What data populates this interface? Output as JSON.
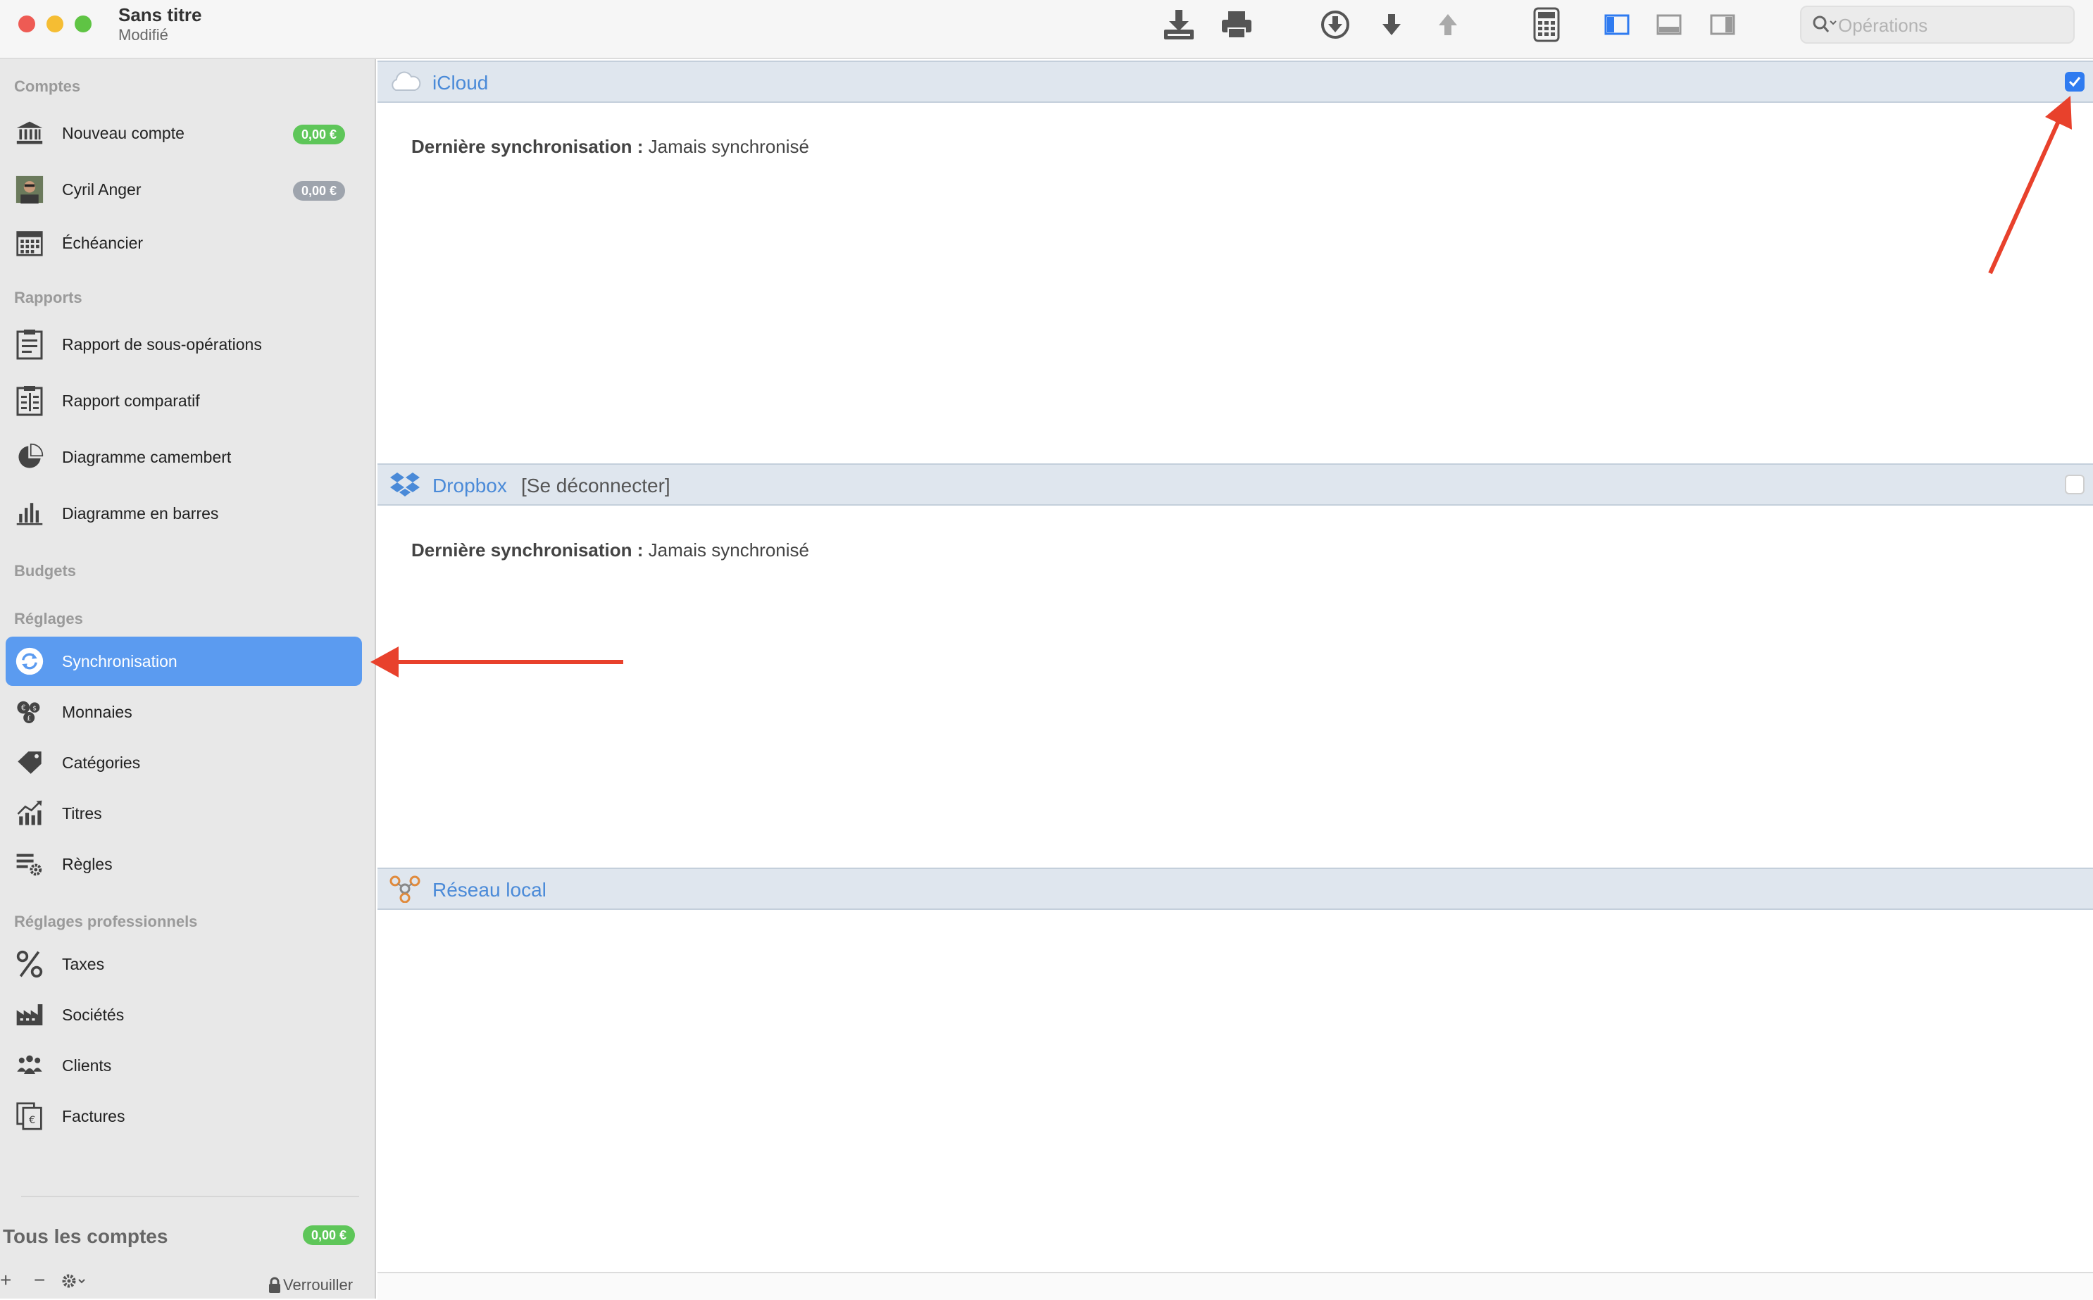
{
  "window": {
    "title": "Sans titre",
    "subtitle": "Modifié"
  },
  "toolbar": {
    "buttons": [
      {
        "name": "import-icon"
      },
      {
        "name": "print-icon"
      },
      {
        "name": "download-circle-icon"
      },
      {
        "name": "arrow-down-icon"
      },
      {
        "name": "arrow-up-icon"
      },
      {
        "name": "calculator-icon"
      },
      {
        "name": "sidebar-left-icon"
      },
      {
        "name": "panel-bottom-icon"
      },
      {
        "name": "sidebar-right-icon"
      }
    ],
    "search_placeholder": "Opérations"
  },
  "sidebar": {
    "sections": {
      "comptes": "Comptes",
      "rapports": "Rapports",
      "budgets": "Budgets",
      "reglages": "Réglages",
      "reglages_pro": "Réglages professionnels"
    },
    "comptes": [
      {
        "label": "Nouveau compte",
        "badge": "0,00 €",
        "badge_color": "#5ec659",
        "icon": "bank-icon"
      },
      {
        "label": "Cyril Anger",
        "badge": "0,00 €",
        "badge_color": "#9ea4ad",
        "icon": "avatar"
      },
      {
        "label": "Échéancier",
        "icon": "calendar-icon"
      }
    ],
    "rapports": [
      {
        "label": "Rapport de sous-opérations",
        "icon": "report-icon"
      },
      {
        "label": "Rapport comparatif",
        "icon": "comparative-report-icon"
      },
      {
        "label": "Diagramme camembert",
        "icon": "pie-chart-icon"
      },
      {
        "label": "Diagramme en barres",
        "icon": "bar-chart-icon"
      }
    ],
    "reglages": [
      {
        "label": "Synchronisation",
        "icon": "sync-icon",
        "selected": true
      },
      {
        "label": "Monnaies",
        "icon": "currencies-icon"
      },
      {
        "label": "Catégories",
        "icon": "tag-icon"
      },
      {
        "label": "Titres",
        "icon": "stocks-icon"
      },
      {
        "label": "Règles",
        "icon": "rules-icon"
      }
    ],
    "reglages_pro": [
      {
        "label": "Taxes",
        "icon": "percent-icon"
      },
      {
        "label": "Sociétés",
        "icon": "factory-icon"
      },
      {
        "label": "Clients",
        "icon": "clients-icon"
      },
      {
        "label": "Factures",
        "icon": "invoices-icon"
      }
    ],
    "footer": {
      "all_accounts_label": "Tous les comptes",
      "all_accounts_badge": "0,00 €",
      "add": "+",
      "remove": "−",
      "lock_label": "Verrouiller"
    }
  },
  "main": {
    "panels": [
      {
        "title": "iCloud",
        "action": "",
        "checked": true,
        "sync_label": "Dernière synchronisation :",
        "sync_value": "Jamais synchronisé"
      },
      {
        "title": "Dropbox",
        "action": "[Se déconnecter]",
        "checked": false,
        "sync_label": "Dernière synchronisation :",
        "sync_value": "Jamais synchronisé"
      },
      {
        "title": "Réseau local",
        "action": "",
        "checked": null
      }
    ]
  },
  "colors": {
    "accent": "#5b9bf0",
    "panel_title": "#4a8ad8",
    "annotation_arrow": "#e8412c"
  }
}
